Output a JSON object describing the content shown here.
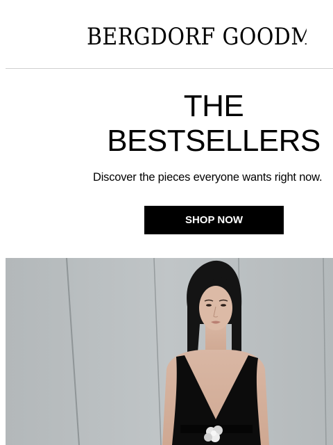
{
  "brand": {
    "logo_text": "BERGDORF GOODMAN"
  },
  "hero": {
    "headline_line1": "THE",
    "headline_line2": "BESTSELLERS",
    "subheadline": "Discover the pieces everyone wants right now.",
    "cta_label": "SHOP NOW"
  },
  "colors": {
    "cta_background": "#000000",
    "cta_text": "#ffffff",
    "divider": "#cfcfcf",
    "wall": "#b8bdbf"
  }
}
